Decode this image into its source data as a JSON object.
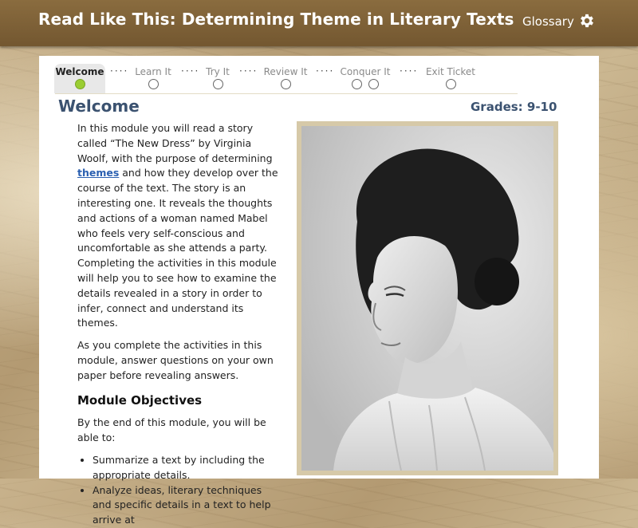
{
  "header": {
    "title": "Read Like This: Determining Theme in Literary Texts",
    "glossary_label": "Glossary",
    "settings_icon": "gear-icon"
  },
  "nav": {
    "steps": [
      {
        "label": "Welcome",
        "circles": 1,
        "status": "active-complete"
      },
      {
        "label": "Learn It",
        "circles": 1,
        "status": "incomplete"
      },
      {
        "label": "Try It",
        "circles": 1,
        "status": "incomplete"
      },
      {
        "label": "Review It",
        "circles": 1,
        "status": "incomplete"
      },
      {
        "label": "Conquer It",
        "circles": 2,
        "status": "incomplete"
      },
      {
        "label": "Exit Ticket",
        "circles": 1,
        "status": "incomplete"
      }
    ],
    "separator": "····"
  },
  "main": {
    "heading": "Welcome",
    "grades": "Grades: 9-10",
    "intro_before_link": "In this module you will read a story called “The New Dress” by Virginia Woolf, with the purpose of determining ",
    "intro_link": "themes",
    "intro_after_link": " and how they develop over the course of the text. The story is an interesting one. It reveals the thoughts and actions of a woman named Mabel who feels very self-conscious and uncomfortable as she attends a party. Completing the activities in this module will help you to see how to examine the details revealed in a story in order to infer, connect and understand its themes.",
    "paragraph2": "As you complete the activities in this module, answer questions on your own paper before revealing answers.",
    "objectives_heading": "Module Objectives",
    "objectives_intro": "By the end of this module, you will be able to:",
    "objectives": [
      "Summarize a text by including the appropriate details.",
      "Analyze ideas, literary techniques and specific details in a text to help arrive at"
    ]
  },
  "colors": {
    "header_bg": "#7d6236",
    "heading_text": "#3b5270",
    "link": "#2a5fb0",
    "complete_circle": "#9acd32",
    "photo_frame": "#d6c9a8"
  }
}
